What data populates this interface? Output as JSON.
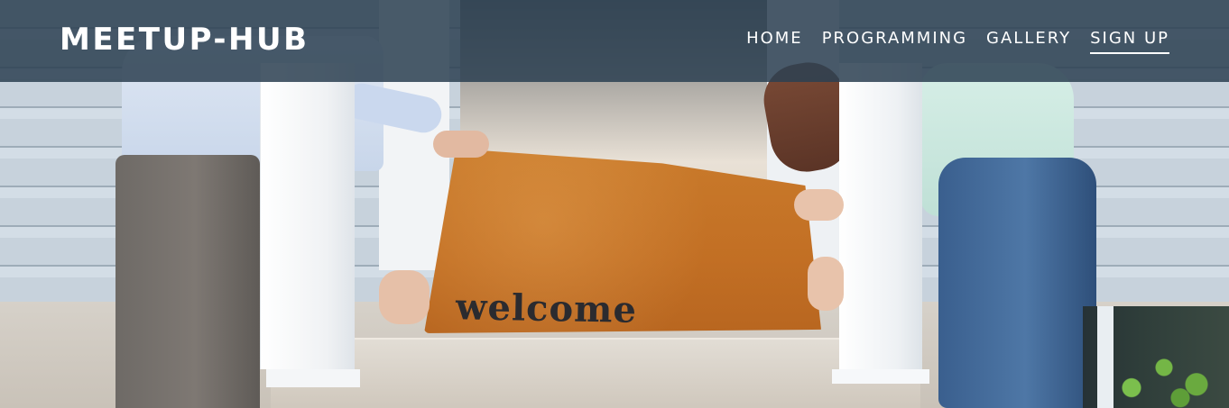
{
  "header": {
    "brand": "MEETUP-HUB",
    "nav": {
      "items": [
        {
          "label": "HOME",
          "active": false
        },
        {
          "label": "PROGRAMMING",
          "active": false
        },
        {
          "label": "GALLERY",
          "active": false
        },
        {
          "label": "SIGN UP",
          "active": true
        }
      ]
    }
  },
  "hero": {
    "mat_text": "welcome"
  },
  "colors": {
    "header_overlay": "#2c4052",
    "text_on_header": "#ffffff",
    "mat_orange": "#c26f24"
  }
}
